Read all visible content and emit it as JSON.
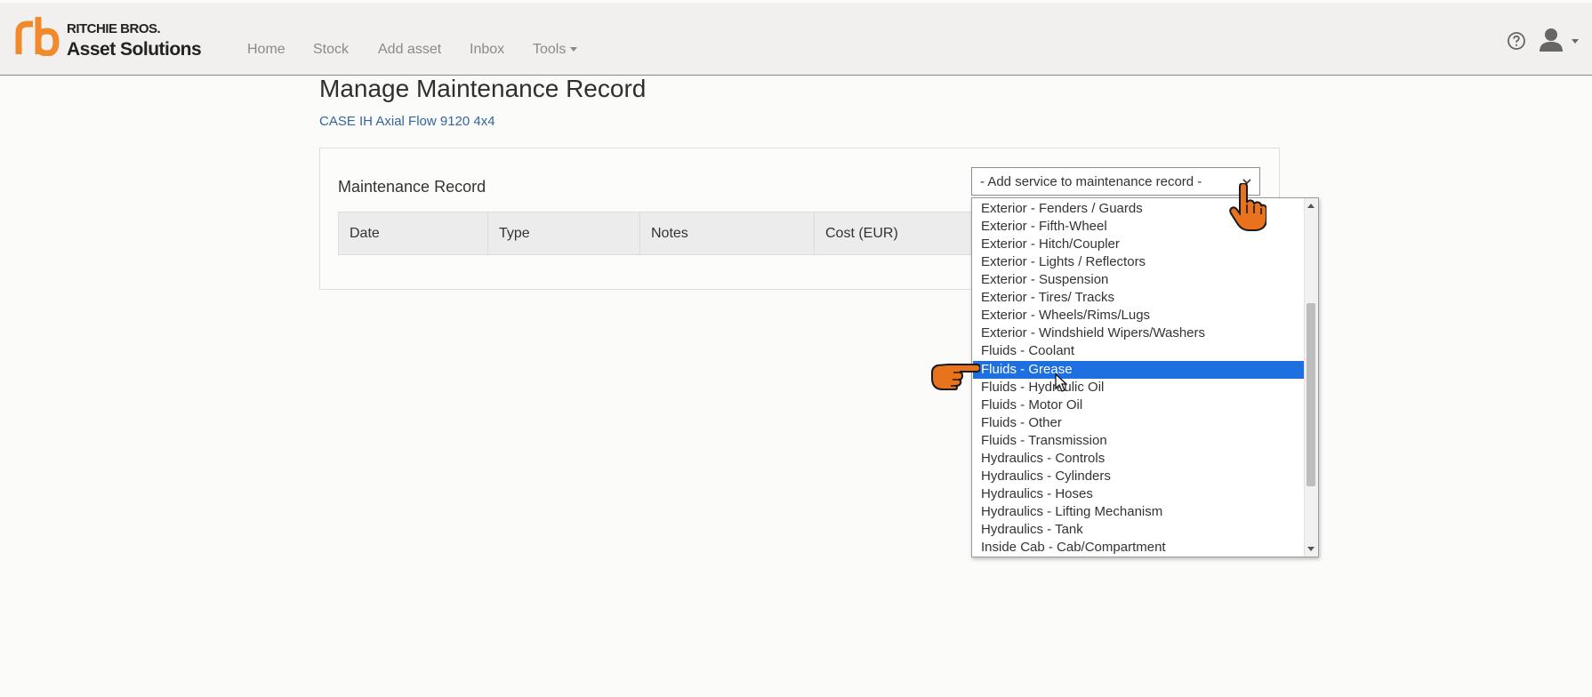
{
  "brand": {
    "line1": "RITCHIE BROS.",
    "line2": "Asset Solutions",
    "color": "#f08a2c"
  },
  "nav": {
    "items": [
      "Home",
      "Stock",
      "Add asset",
      "Inbox",
      "Tools"
    ]
  },
  "header_icons": {
    "help": "help-circle-icon",
    "user": "user-icon"
  },
  "page": {
    "title": "Manage Maintenance Record",
    "asset_name": "CASE IH Axial Flow 9120 4x4"
  },
  "card": {
    "title": "Maintenance Record",
    "columns": [
      "Date",
      "Type",
      "Notes",
      "Cost (EUR)"
    ]
  },
  "service_select": {
    "placeholder": "- Add service to maintenance record -",
    "selected_option": "Fluids - Grease",
    "options": [
      "Exterior - Fenders / Guards",
      "Exterior - Fifth-Wheel",
      "Exterior - Hitch/Coupler",
      "Exterior - Lights / Reflectors",
      "Exterior - Suspension",
      "Exterior - Tires/ Tracks",
      "Exterior - Wheels/Rims/Lugs",
      "Exterior - Windshield Wipers/Washers",
      "Fluids - Coolant",
      "Fluids - Grease",
      "Fluids - Hydraulic Oil",
      "Fluids - Motor Oil",
      "Fluids - Other",
      "Fluids - Transmission",
      "Hydraulics - Controls",
      "Hydraulics - Cylinders",
      "Hydraulics - Hoses",
      "Hydraulics - Lifting Mechanism",
      "Hydraulics - Tank",
      "Inside Cab - Cab/Compartment"
    ],
    "highlight_color": "#1e6fe0"
  },
  "colors": {
    "link": "#34659e",
    "header_bg": "#f1f0ee",
    "hand_cursor": "#e8731c"
  }
}
